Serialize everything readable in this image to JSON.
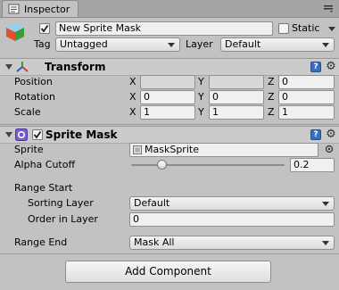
{
  "tab": {
    "title": "Inspector",
    "icon": "inspector-icon",
    "menu_icon": "menu-dots-icon"
  },
  "object": {
    "icon": "gameobject-cube-icon",
    "active": true,
    "name": "New Sprite Mask",
    "static_label": "Static",
    "static_checked": false,
    "tag_label": "Tag",
    "tag_value": "Untagged",
    "layer_label": "Layer",
    "layer_value": "Default"
  },
  "transform": {
    "title": "Transform",
    "icon": "transform-axes-icon",
    "rows": [
      {
        "label": "Position",
        "x": "",
        "y": "",
        "z": "0",
        "disabled": true
      },
      {
        "label": "Rotation",
        "x": "0",
        "y": "0",
        "z": "0",
        "disabled": false
      },
      {
        "label": "Scale",
        "x": "1",
        "y": "1",
        "z": "1",
        "disabled": false
      }
    ],
    "axis": {
      "x": "X",
      "y": "Y",
      "z": "Z"
    }
  },
  "sprite_mask": {
    "title": "Sprite Mask",
    "icon": "sprite-mask-icon",
    "enabled": true,
    "sprite_label": "Sprite",
    "sprite_value": "MaskSprite",
    "alpha_label": "Alpha Cutoff",
    "alpha_value": "0.2",
    "alpha_fraction": 0.2,
    "range_start_label": "Range Start",
    "sorting_layer_label": "Sorting Layer",
    "sorting_layer_value": "Default",
    "order_label": "Order in Layer",
    "order_value": "0",
    "range_end_label": "Range End",
    "range_end_value": "Mask All"
  },
  "add_component_label": "Add Component",
  "colors": {
    "background": "#c2c2c2",
    "header": "#cbcbcb",
    "accent": "#3b6dc4",
    "mask_icon": "#7a5ccf"
  }
}
